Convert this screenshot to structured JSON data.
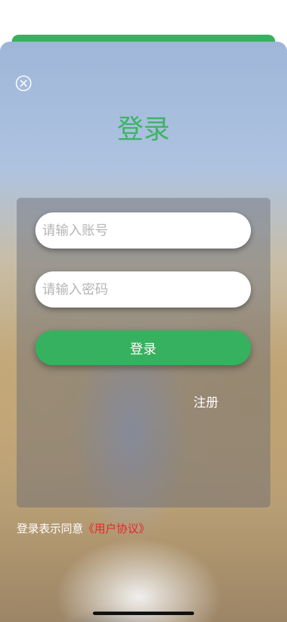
{
  "header": {
    "title": "登录"
  },
  "icons": {
    "close": "close-circle-icon"
  },
  "form": {
    "account_placeholder": "请输入账号",
    "account_value": "",
    "password_placeholder": "请输入密码",
    "password_value": "",
    "login_label": "登录",
    "register_label": "注册"
  },
  "agreement": {
    "prefix": "登录表示同意",
    "link": "《用户协议》"
  },
  "colors": {
    "brand_green": "#36b15f",
    "title_green": "#3cb464",
    "link_red": "#e8262a"
  }
}
